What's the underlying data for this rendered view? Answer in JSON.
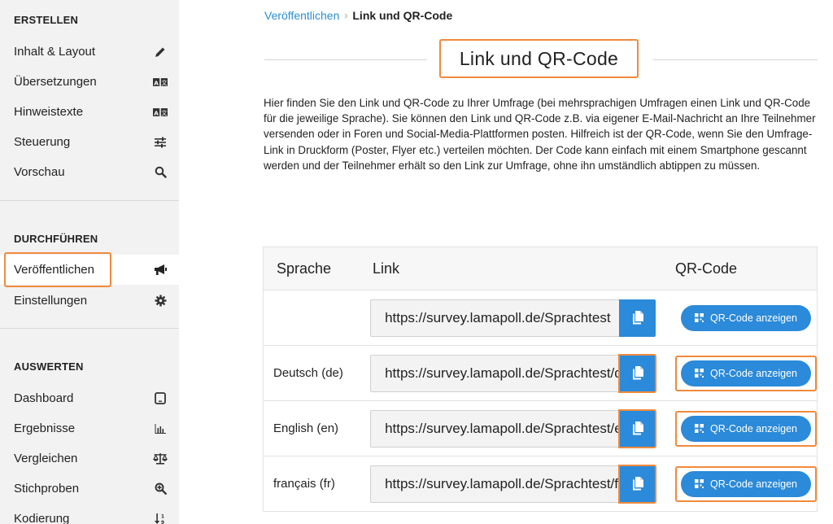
{
  "sidebar": {
    "sections": [
      {
        "title": "ERSTELLEN",
        "items": [
          {
            "label": "Inhalt & Layout",
            "icon": "pencil-icon"
          },
          {
            "label": "Übersetzungen",
            "icon": "translate-icon"
          },
          {
            "label": "Hinweistexte",
            "icon": "translate-icon"
          },
          {
            "label": "Steuerung",
            "icon": "sliders-icon"
          },
          {
            "label": "Vorschau",
            "icon": "search-icon"
          }
        ]
      },
      {
        "title": "DURCHFÜHREN",
        "items": [
          {
            "label": "Veröffentlichen",
            "icon": "megaphone-icon",
            "active": true
          },
          {
            "label": "Einstellungen",
            "icon": "gear-icon"
          }
        ]
      },
      {
        "title": "AUSWERTEN",
        "items": [
          {
            "label": "Dashboard",
            "icon": "tablet-icon"
          },
          {
            "label": "Ergebnisse",
            "icon": "bar-chart-icon"
          },
          {
            "label": "Vergleichen",
            "icon": "scale-icon"
          },
          {
            "label": "Stichproben",
            "icon": "zoom-in-icon"
          },
          {
            "label": "Kodierung",
            "icon": "sort-icon"
          }
        ]
      }
    ]
  },
  "breadcrumb": {
    "parent": "Veröffentlichen",
    "separator": "›",
    "current": "Link und QR-Code"
  },
  "page_title": "Link und QR-Code",
  "intro_text": "Hier finden Sie den Link und QR-Code zu Ihrer Umfrage (bei mehrsprachigen Umfragen einen Link und QR-Code für die jeweilige Sprache). Sie können den Link und QR-Code z.B. via eigener E-Mail-Nachricht an Ihre Teilnehmer versenden oder in Foren und Social-Media-Plattformen posten. Hilfreich ist der QR-Code, wenn Sie den Umfrage-Link in Druckform (Poster, Flyer etc.) verteilen möchten. Der Code kann einfach mit einem Smartphone gescannt werden und der Teilnehmer erhält so den Link zur Umfrage, ohne ihn umständlich abtippen zu müssen.",
  "table": {
    "headers": {
      "language": "Sprache",
      "link": "Link",
      "qr": "QR-Code"
    },
    "rows": [
      {
        "language": "",
        "link": "https://survey.lamapoll.de/Sprachtest",
        "qr_label": "QR-Code anzeigen"
      },
      {
        "language": "Deutsch (de)",
        "link": "https://survey.lamapoll.de/Sprachtest/de",
        "qr_label": "QR-Code anzeigen"
      },
      {
        "language": "English (en)",
        "link": "https://survey.lamapoll.de/Sprachtest/en",
        "qr_label": "QR-Code anzeigen"
      },
      {
        "language": "français (fr)",
        "link": "https://survey.lamapoll.de/Sprachtest/fr",
        "qr_label": "QR-Code anzeigen"
      }
    ]
  },
  "colors": {
    "accent": "#2b8ad9",
    "highlight": "#f08a3c",
    "sidebar_bg": "#f2f2f2"
  }
}
